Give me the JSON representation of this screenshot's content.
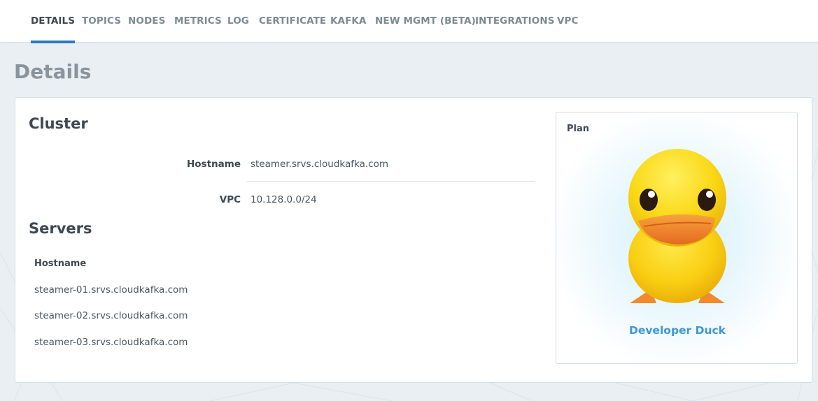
{
  "tabs": [
    {
      "label": "DETAILS",
      "active": true
    },
    {
      "label": "TOPICS",
      "active": false
    },
    {
      "label": "NODES",
      "active": false
    },
    {
      "label": "METRICS",
      "active": false
    },
    {
      "label": "LOG",
      "active": false
    },
    {
      "label": "CERTIFICATE",
      "active": false
    },
    {
      "label": "KAFKA",
      "active": false
    },
    {
      "label": "NEW MGMT (BETA)",
      "active": false
    },
    {
      "label": "INTEGRATIONS",
      "active": false
    },
    {
      "label": "VPC",
      "active": false
    }
  ],
  "page_title": "Details",
  "cluster": {
    "title": "Cluster",
    "fields": [
      {
        "label": "Hostname",
        "value": "steamer.srvs.cloudkafka.com"
      },
      {
        "label": "VPC",
        "value": "10.128.0.0/24"
      }
    ]
  },
  "servers": {
    "title": "Servers",
    "column_header": "Hostname",
    "rows": [
      "steamer-01.srvs.cloudkafka.com",
      "steamer-02.srvs.cloudkafka.com",
      "steamer-03.srvs.cloudkafka.com"
    ]
  },
  "plan": {
    "label": "Plan",
    "name": "Developer Duck",
    "icon": "duck-icon"
  },
  "colors": {
    "accent": "#2a7cbd",
    "link": "#3d97d4",
    "background": "#e9eff3"
  }
}
